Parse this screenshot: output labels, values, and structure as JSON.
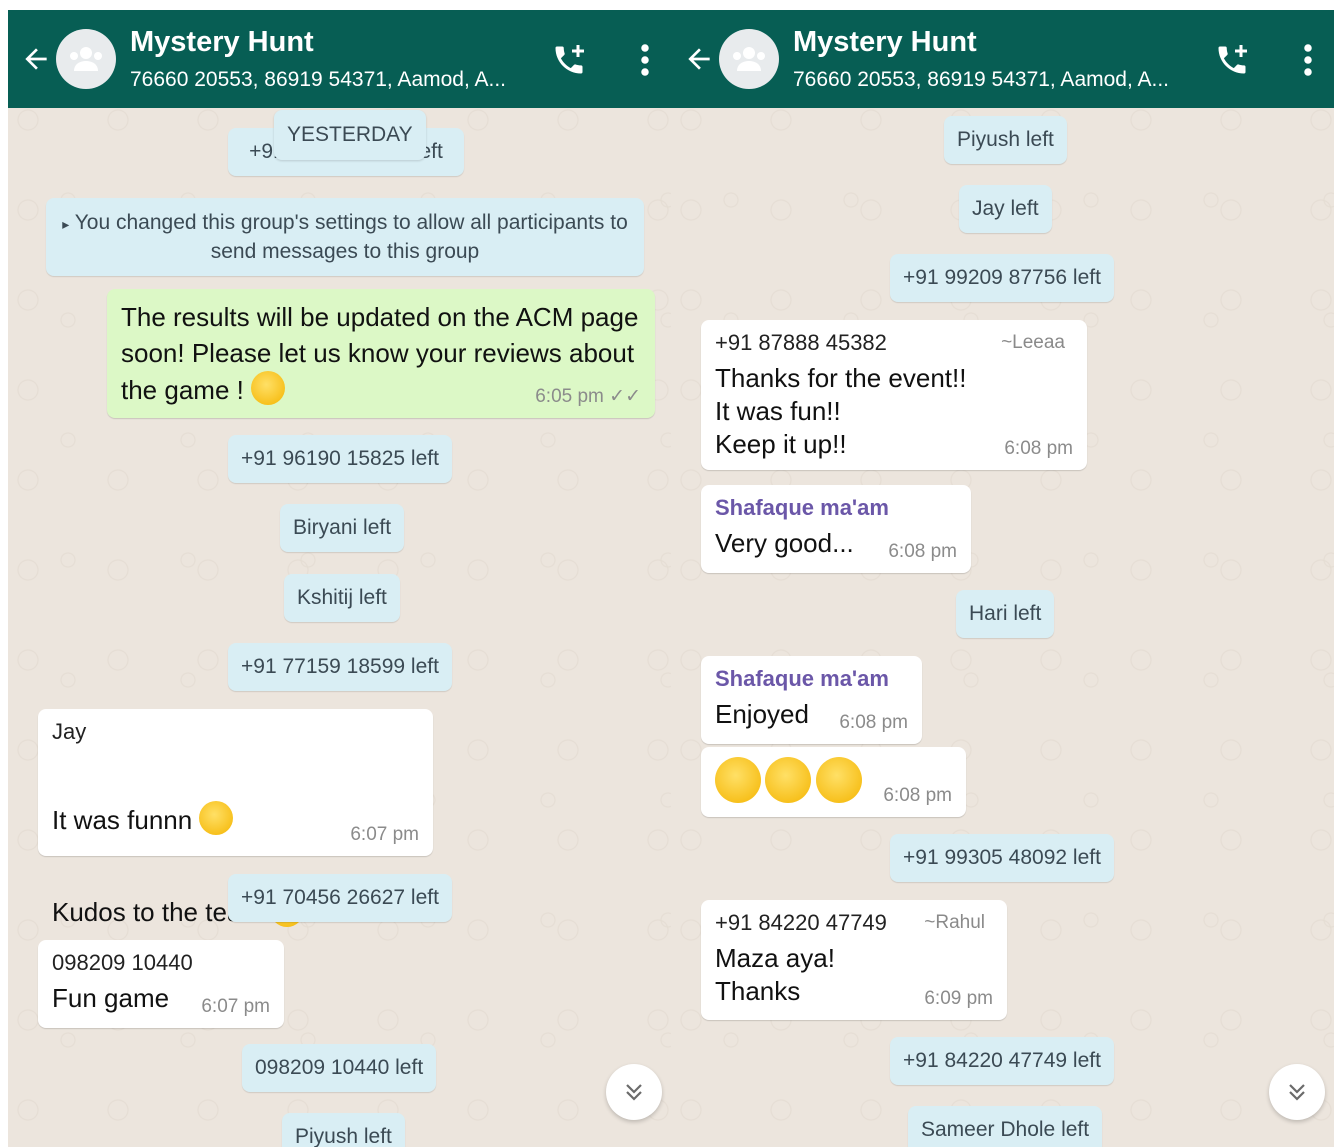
{
  "chat": {
    "title": "Mystery Hunt",
    "subtitle": "76660 20553, 86919 54371, Aamod, A..."
  },
  "left": {
    "yesterday_partial_prefix": "+91",
    "yesterday_partial_suffix": "left",
    "date_chip": "YESTERDAY",
    "banner": "You changed this group's settings to allow all participants to send messages to this group",
    "own_message": {
      "text": "The results will be updated on the ACM page soon! Please let us know your reviews about the game !",
      "time": "6:05 pm"
    },
    "notices": [
      "+91 96190 15825 left",
      "Biryani left",
      "Kshitij left",
      "+91 77159 18599 left",
      "+91 70456 26627 left",
      "098209 10440 left",
      "Piyush left"
    ],
    "jay": {
      "sender": "Jay",
      "line1": "It was funnn",
      "line2": "Kudos to the team!",
      "time": "6:07 pm"
    },
    "fun": {
      "sender": "098209 10440",
      "text": "Fun game",
      "time": "6:07 pm"
    }
  },
  "right": {
    "notices": [
      "Piyush left",
      "Jay left",
      "+91 99209 87756 left",
      "Hari left",
      "+91 99305 48092 left",
      "+91 84220 47749 left",
      "Sameer Dhole left"
    ],
    "leeaa": {
      "sender": "+91 87888 45382",
      "name": "~Leeaa",
      "text": "Thanks for the event!!\nIt was fun!!\nKeep it up!!",
      "time": "6:08 pm"
    },
    "shafaque1": {
      "sender": "Shafaque ma'am",
      "text": "Very good...",
      "time": "6:08 pm"
    },
    "shafaque2": {
      "sender": "Shafaque ma'am",
      "text": "Enjoyed",
      "time": "6:08 pm"
    },
    "emoji_msg": {
      "time": "6:08 pm"
    },
    "rahul": {
      "sender": "+91 84220 47749",
      "name": "~Rahul",
      "text": "Maza aya!\nThanks",
      "time": "6:09 pm"
    }
  },
  "icons": {
    "back": "arrow-left-icon",
    "avatar": "group-avatar-icon",
    "call": "add-call-icon",
    "menu": "more-vertical-icon",
    "scroll": "double-chevron-down-icon",
    "mute": "megaphone-icon"
  },
  "colors": {
    "header": "#075e54",
    "outgoing": "#dcf8c6",
    "system": "#d9eef4",
    "accent_name": "#6b57a8"
  }
}
